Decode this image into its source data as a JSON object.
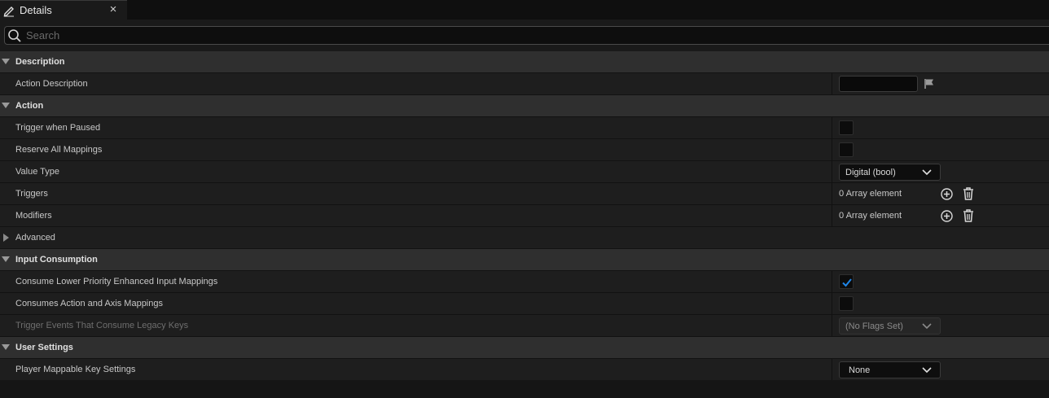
{
  "tab": {
    "title": "Details",
    "icon": "pencil-icon",
    "close_glyph": "×"
  },
  "search": {
    "placeholder": "Search",
    "value": ""
  },
  "colors": {
    "accent": "#1f86e8",
    "category_bg": "#2f2f2f",
    "row_bg": "#1e1e1e"
  },
  "sections": {
    "description": {
      "title": "Description",
      "action_description": {
        "label": "Action Description",
        "value": ""
      }
    },
    "action": {
      "title": "Action",
      "trigger_when_paused": {
        "label": "Trigger when Paused",
        "checked": false
      },
      "reserve_all_mappings": {
        "label": "Reserve All Mappings",
        "checked": false
      },
      "value_type": {
        "label": "Value Type",
        "selected": "Digital (bool)"
      },
      "triggers": {
        "label": "Triggers",
        "value": "0 Array element"
      },
      "modifiers": {
        "label": "Modifiers",
        "value": "0 Array element"
      },
      "advanced": {
        "label": "Advanced"
      }
    },
    "input_consumption": {
      "title": "Input Consumption",
      "consume_lower_priority": {
        "label": "Consume Lower Priority Enhanced Input Mappings",
        "checked": true
      },
      "consumes_action_axis": {
        "label": "Consumes Action and Axis Mappings",
        "checked": false
      },
      "trigger_events_legacy": {
        "label": "Trigger Events That Consume Legacy Keys",
        "selected": "(No Flags Set)"
      }
    },
    "user_settings": {
      "title": "User Settings",
      "player_mappable": {
        "label": "Player Mappable Key Settings",
        "selected": "None"
      }
    }
  }
}
